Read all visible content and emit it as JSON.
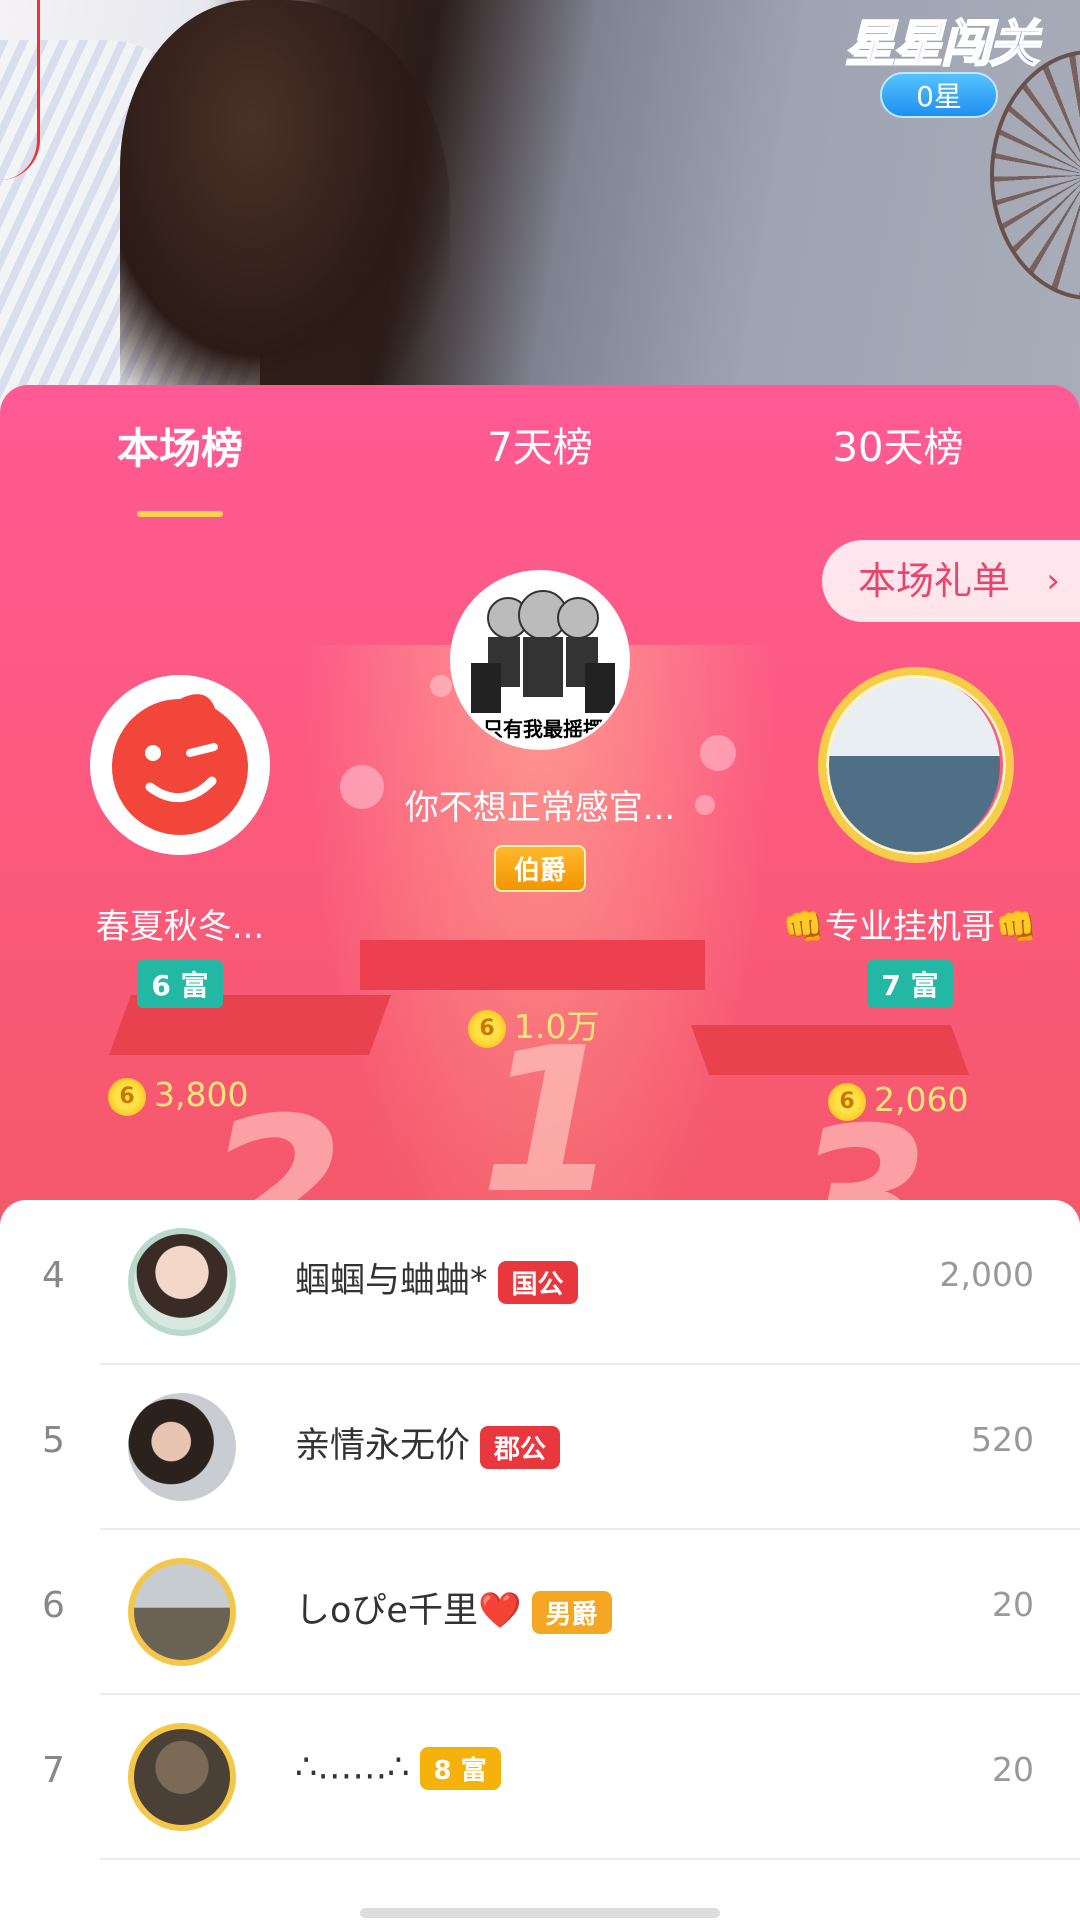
{
  "overlay": {
    "game_title": "星星闯关",
    "stars": "0星"
  },
  "tabs": [
    {
      "label": "本场榜"
    },
    {
      "label": "7天榜"
    },
    {
      "label": "30天榜"
    }
  ],
  "gift_list_button": "本场礼单",
  "top3": {
    "first": {
      "name": "你不想正常感官...",
      "title": "伯爵",
      "coins": "1.0万",
      "avatar_caption": "只有我最摇摆",
      "rank_mark": "1"
    },
    "second": {
      "name": "春夏秋冬...",
      "rich_level": "6 富",
      "coins": "3,800",
      "rank_mark": "2"
    },
    "third": {
      "name": "👊专业挂机哥👊",
      "rich_level": "7 富",
      "coins": "2,060",
      "rank_mark": "3"
    }
  },
  "coin_glyph": "6",
  "list": [
    {
      "rank": "4",
      "name": "蝈蝈与蛐蛐*",
      "badge": "国公",
      "badge_color": "#e8383d",
      "score": "2,000"
    },
    {
      "rank": "5",
      "name": "亲情永无价",
      "badge": "郡公",
      "badge_color": "#e8383d",
      "score": "520"
    },
    {
      "rank": "6",
      "name": "しoぴe千里❤️",
      "badge": "男爵",
      "badge_color": "#f5a623",
      "score": "20"
    },
    {
      "rank": "7",
      "name": "∴……∴",
      "badge": "8 富",
      "badge_color": "#f5b20d",
      "score": "20"
    }
  ]
}
